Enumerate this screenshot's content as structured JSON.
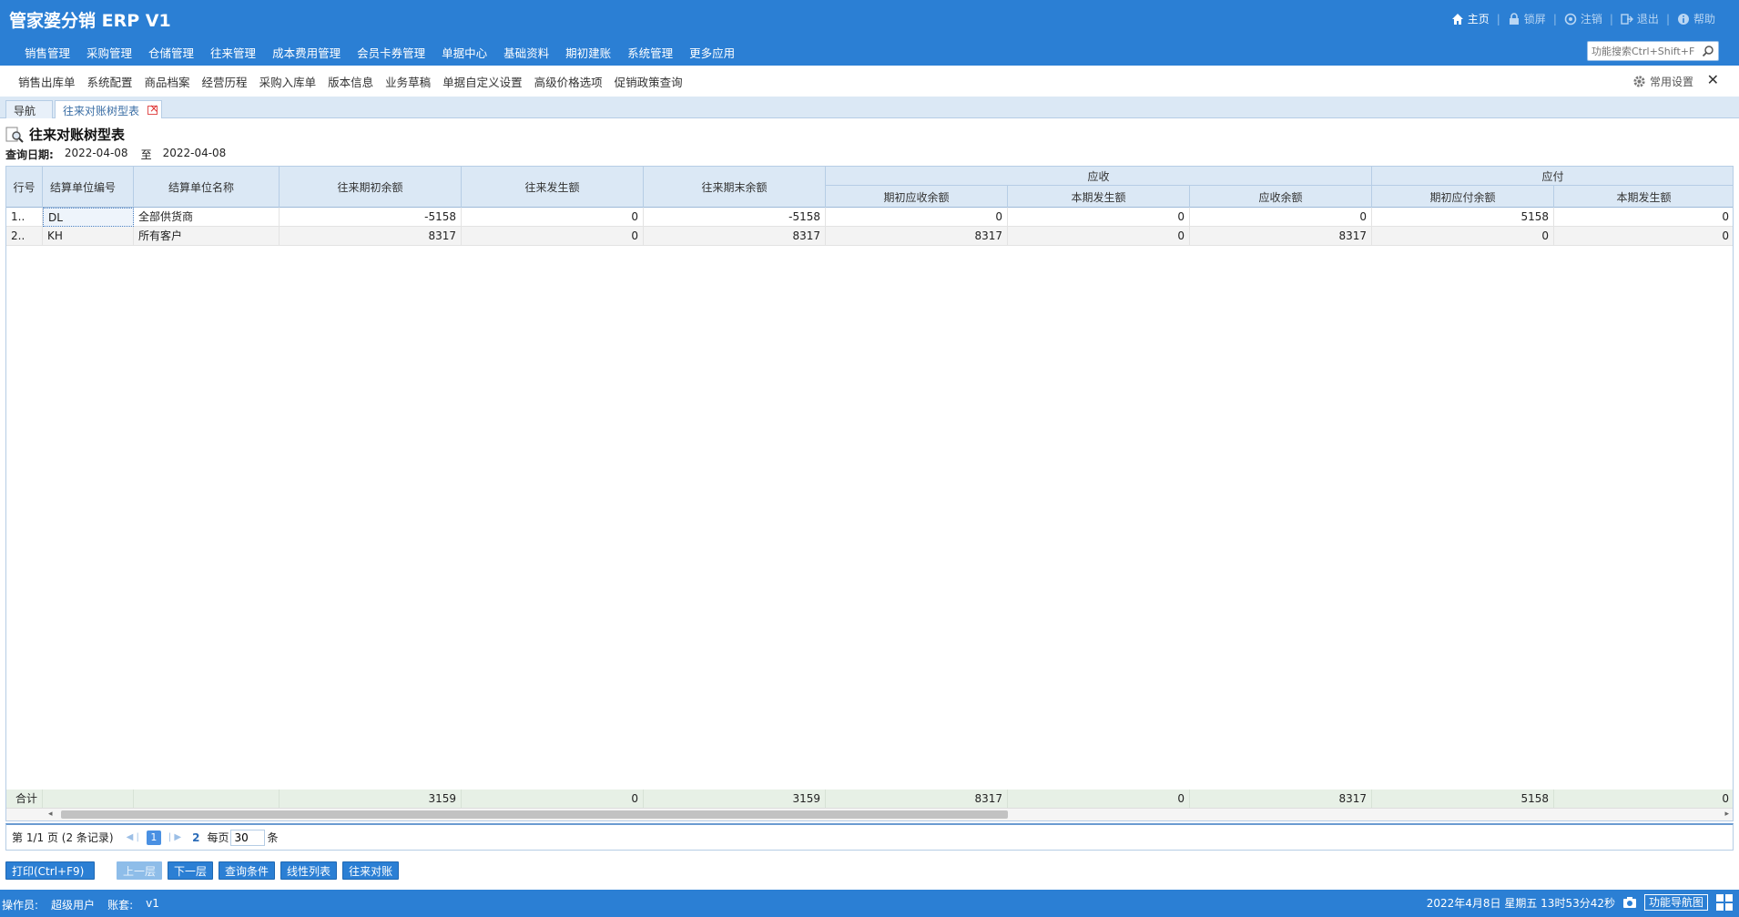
{
  "app": {
    "title": "管家婆分销 ERP V1"
  },
  "top_links": [
    {
      "label": "主页",
      "icon": "home-icon"
    },
    {
      "label": "锁屏",
      "icon": "lock-icon"
    },
    {
      "label": "注销",
      "icon": "logout-icon"
    },
    {
      "label": "退出",
      "icon": "exit-icon"
    },
    {
      "label": "帮助",
      "icon": "help-icon"
    }
  ],
  "main_menu": [
    "销售管理",
    "采购管理",
    "仓储管理",
    "往来管理",
    "成本费用管理",
    "会员卡券管理",
    "单据中心",
    "基础资料",
    "期初建账",
    "系统管理",
    "更多应用"
  ],
  "search": {
    "placeholder": "功能搜索Ctrl+Shift+F"
  },
  "quick_items": [
    "销售出库单",
    "系统配置",
    "商品档案",
    "经营历程",
    "采购入库单",
    "版本信息",
    "业务草稿",
    "单据自定义设置",
    "高级价格选项",
    "促销政策查询"
  ],
  "quick_settings": "常用设置",
  "tabs": {
    "nav": "导航",
    "active": "往来对账树型表"
  },
  "report": {
    "title": "往来对账树型表",
    "date_label": "查询日期:",
    "date_from": "2022-04-08",
    "date_to_label": "至",
    "date_to": "2022-04-08"
  },
  "grid": {
    "headers": {
      "row_no": "行号",
      "code": "结算单位编号",
      "name": "结算单位名称",
      "opening": "往来期初余额",
      "occur": "往来发生额",
      "closing": "往来期末余额",
      "group_receivable": "应收",
      "recv_opening": "期初应收余额",
      "recv_occur": "本期发生额",
      "recv_balance": "应收余额",
      "group_payable": "应付",
      "pay_opening": "期初应付余额",
      "pay_occur": "本期发生额"
    },
    "rows": [
      {
        "no": "1..",
        "code": "DL",
        "name": "全部供货商",
        "opening": "-5158",
        "occur": "0",
        "closing": "-5158",
        "recv_opening": "0",
        "recv_occur": "0",
        "recv_balance": "0",
        "pay_opening": "5158",
        "pay_occur": "0"
      },
      {
        "no": "2..",
        "code": "KH",
        "name": "所有客户",
        "opening": "8317",
        "occur": "0",
        "closing": "8317",
        "recv_opening": "8317",
        "recv_occur": "0",
        "recv_balance": "8317",
        "pay_opening": "0",
        "pay_occur": "0"
      }
    ],
    "footer": {
      "label": "合计",
      "opening": "3159",
      "occur": "0",
      "closing": "3159",
      "recv_opening": "8317",
      "recv_occur": "0",
      "recv_balance": "8317",
      "pay_opening": "5158",
      "pay_occur": "0"
    }
  },
  "pager": {
    "page_info": "第  1/1 页  (2 条记录)",
    "current_page": "1",
    "next_page": "2",
    "per_page_label": "每页",
    "per_page": "30",
    "unit": "条"
  },
  "buttons": {
    "print": "打印(Ctrl+F9)",
    "up_level": "上一层",
    "down_level": "下一层",
    "query": "查询条件",
    "linear": "线性列表",
    "reconcile": "往来对账"
  },
  "status": {
    "operator_label": "操作员:",
    "operator": "超级用户",
    "account_label": "账套:",
    "account": "v1",
    "datetime": "2022年4月8日  星期五  13时53分42秒",
    "nav_map": "功能导航图"
  },
  "colors": {
    "brand": "#2b7fd4",
    "header_bg": "#dbe8f5",
    "footer_bg": "#e7f0e6"
  }
}
